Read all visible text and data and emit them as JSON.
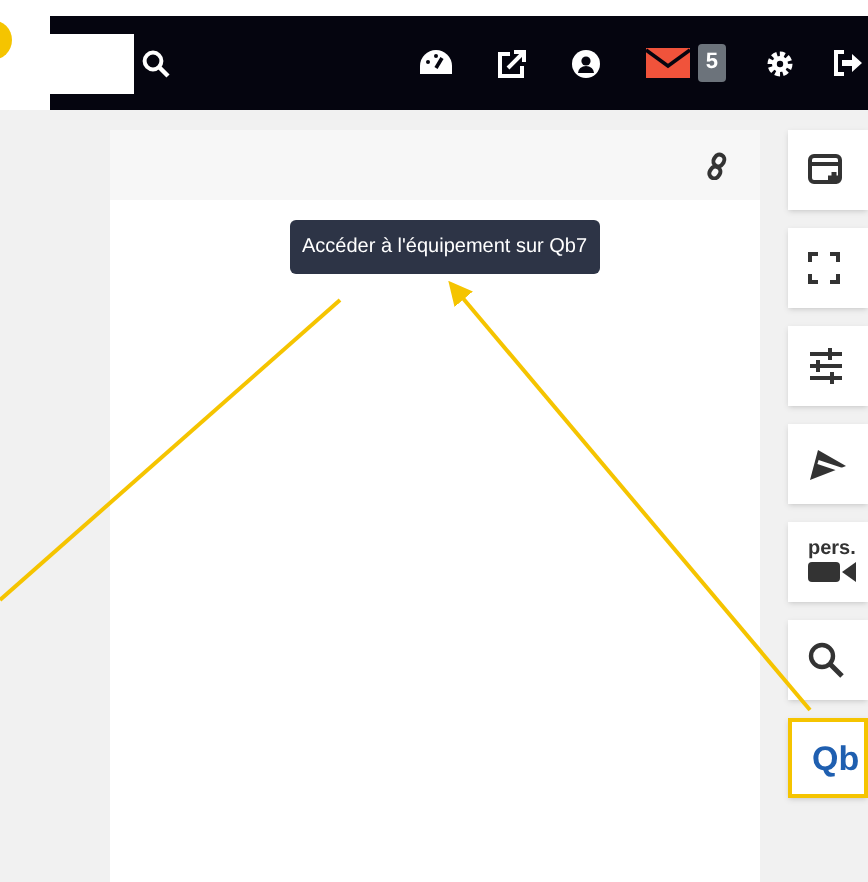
{
  "navbar": {
    "badge": "5"
  },
  "panel": {
    "tooltip": "Accéder à l'équipement sur Qb7"
  },
  "side_buttons": [
    {
      "kind": "icon"
    },
    {
      "kind": "icon"
    },
    {
      "kind": "icon"
    },
    {
      "kind": "icon"
    },
    {
      "kind": "labeled",
      "label": "pers."
    },
    {
      "kind": "icon"
    },
    {
      "kind": "text",
      "label": "Qb",
      "selected": true
    }
  ]
}
